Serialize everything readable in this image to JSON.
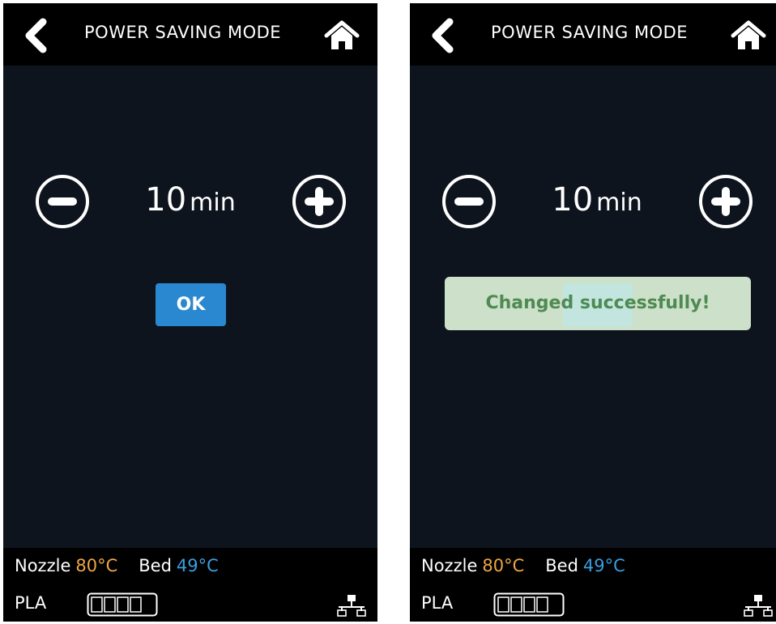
{
  "screens": [
    {
      "header": {
        "title": "POWER SAVING MODE",
        "back_icon": "chevron-left-icon",
        "home_icon": "home-icon"
      },
      "setting": {
        "value": "10",
        "unit": "min",
        "decrease_icon": "minus-circle-icon",
        "increase_icon": "plus-circle-icon"
      },
      "ok_label": "OK",
      "status": {
        "nozzle_label": "Nozzle",
        "nozzle_temp": "80°C",
        "bed_label": "Bed",
        "bed_temp": "49°C",
        "filament": "PLA",
        "network_icon": "network-icon",
        "filament_gauge_icon": "filament-gauge-icon"
      }
    },
    {
      "header": {
        "title": "POWER SAVING MODE",
        "back_icon": "chevron-left-icon",
        "home_icon": "home-icon"
      },
      "setting": {
        "value": "10",
        "unit": "min",
        "decrease_icon": "minus-circle-icon",
        "increase_icon": "plus-circle-icon"
      },
      "toast": "Changed successfully!",
      "status": {
        "nozzle_label": "Nozzle",
        "nozzle_temp": "80°C",
        "bed_label": "Bed",
        "bed_temp": "49°C",
        "filament": "PLA",
        "network_icon": "network-icon",
        "filament_gauge_icon": "filament-gauge-icon"
      }
    }
  ],
  "colors": {
    "background": "#0e141e",
    "bar": "#000000",
    "accent_button": "#2a88d0",
    "nozzle_temp": "#f0a548",
    "bed_temp": "#3a9ee0",
    "toast_bg": "#cde0c9",
    "toast_text": "#4e8a52"
  }
}
